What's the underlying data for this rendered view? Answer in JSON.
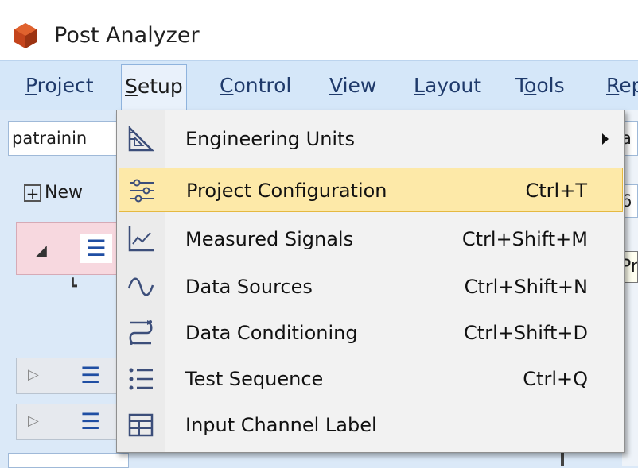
{
  "window": {
    "title": "Post Analyzer",
    "icon": "app-hexagon-icon"
  },
  "menubar": {
    "items": [
      {
        "label": "Project",
        "ul": "P"
      },
      {
        "label": "Setup",
        "ul": "S"
      },
      {
        "label": "Control",
        "ul": "C"
      },
      {
        "label": "View",
        "ul": "V"
      },
      {
        "label": "Layout",
        "ul": "L"
      },
      {
        "label": "Tools",
        "ul": "o"
      },
      {
        "label": "Rep",
        "ul": "R"
      }
    ],
    "active": "Setup"
  },
  "left_panel": {
    "project_name": "patrainin",
    "new_button": "New"
  },
  "right_panel": {
    "field1": "a",
    "field2": "6",
    "tooltip_fragment": "Pr"
  },
  "setup_menu": {
    "items": [
      {
        "label": "Engineering Units",
        "shortcut": "",
        "icon": "engineering-units-icon",
        "submenu": true
      },
      {
        "label": "Project Configuration",
        "shortcut": "Ctrl+T",
        "icon": "project-configuration-icon",
        "highlighted": true
      },
      {
        "label": "Measured Signals",
        "shortcut": "Ctrl+Shift+M",
        "icon": "measured-signals-icon"
      },
      {
        "label": "Data Sources",
        "shortcut": "Ctrl+Shift+N",
        "icon": "data-sources-icon"
      },
      {
        "label": "Data Conditioning",
        "shortcut": "Ctrl+Shift+D",
        "icon": "data-conditioning-icon"
      },
      {
        "label": "Test Sequence",
        "shortcut": "Ctrl+Q",
        "icon": "test-sequence-icon"
      },
      {
        "label": "Input Channel Label",
        "shortcut": "",
        "icon": "input-channel-label-icon"
      }
    ]
  },
  "colors": {
    "menubar": "#d5e7f9",
    "highlight": "#fde9a8",
    "highlight_border": "#e5b941",
    "accent": "#1f4ea3"
  }
}
